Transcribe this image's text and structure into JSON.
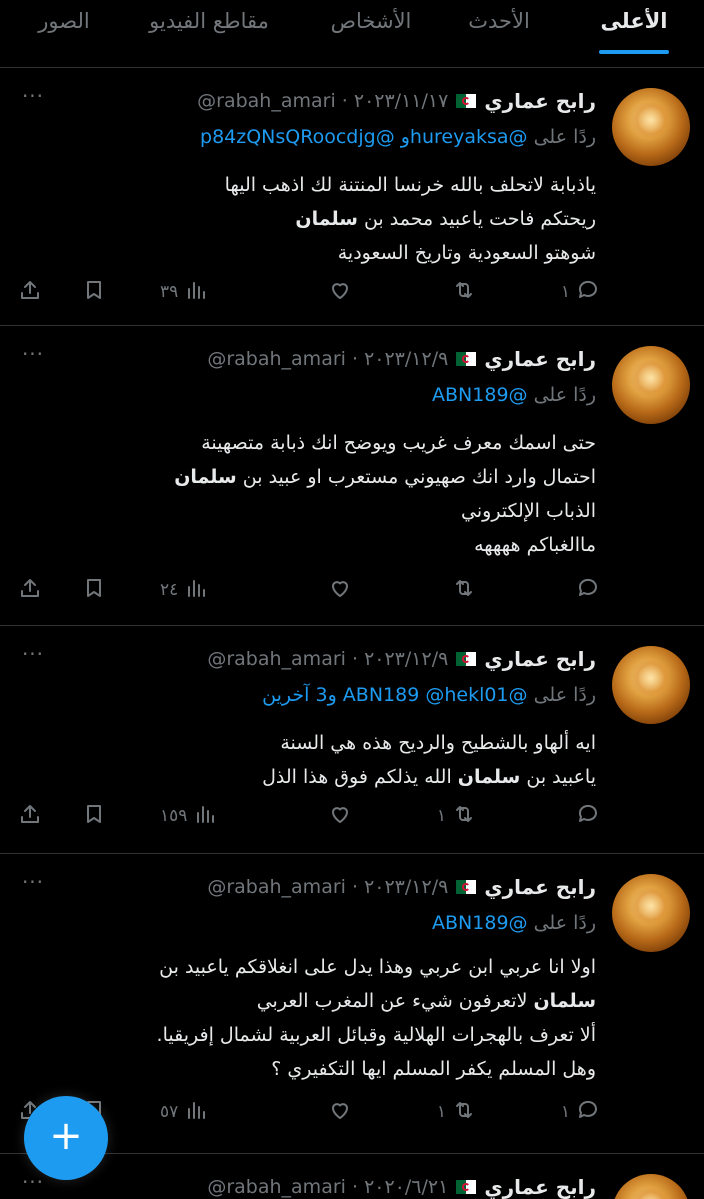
{
  "tabs": [
    {
      "label": "الأعلى",
      "active": true
    },
    {
      "label": "الأحدث",
      "active": false
    },
    {
      "label": "الأشخاص",
      "active": false
    },
    {
      "label": "مقاطع الفيديو",
      "active": false
    },
    {
      "label": "الصور",
      "active": false
    }
  ],
  "tweets": [
    {
      "name": "رابح عماري",
      "meta": "@rabah_amari · ٢٠٢٣/١١/١٧",
      "reply_prefix": "ردًا على ",
      "reply_handles": "@hureyaksa‏و @p84zQNsQRoocdjg",
      "body_html_lines": [
        "ياذبابة لاتحلف بالله خرنسا المنتنة لك اذهب اليها",
        "ريحتكم فاحت ياعبيد محمد بن |سلمان|",
        "شوهتو السعودية وتاريخ السعودية"
      ],
      "replies": "١",
      "retweets": "",
      "likes": "",
      "views": "٣٩"
    },
    {
      "name": "رابح عماري",
      "meta": "@rabah_amari · ٢٠٢٣/١٢/٩",
      "reply_prefix": "ردًا على ",
      "reply_handles": "@ABN189",
      "body_html_lines": [
        "حتى اسمك معرف غريب ويوضح انك ذبابة متصهينة",
        "احتمال وارد انك صهيوني مستعرب او عبيد بن |سلمان|",
        "الذباب الإلكتروني",
        "ماالغباكم ههههه"
      ],
      "replies": "",
      "retweets": "",
      "likes": "",
      "views": "٢٤"
    },
    {
      "name": "رابح عماري",
      "meta": "@rabah_amari · ٢٠٢٣/١٢/٩",
      "reply_prefix": "ردًا على ",
      "reply_handles": "@ABN189 @hekl01 و3 آخرين",
      "body_html_lines": [
        "ايه ألهاو بالشطيح والرديح هذه هي السنة",
        "ياعبيد بن |سلمان| الله يذلكم فوق هذا الذل"
      ],
      "replies": "",
      "retweets": "١",
      "likes": "",
      "views": "١٥٩"
    },
    {
      "name": "رابح عماري",
      "meta": "@rabah_amari · ٢٠٢٣/١٢/٩",
      "reply_prefix": "ردًا على ",
      "reply_handles": "@ABN189",
      "body_html_lines": [
        "اولا انا عربي ابن عربي وهذا يدل على انغلاقكم ياعبيد بن",
        "|سلمان| لاتعرفون  شيء عن المغرب العربي",
        "ألا تعرف بالهجرات الهلالية وقبائل العربية لشمال إفريقيا.",
        "وهل المسلم يكفر المسلم ايها التكفيري ؟"
      ],
      "replies": "١",
      "retweets": "١",
      "likes": "",
      "views": "٥٧"
    },
    {
      "name": "رابح عماري",
      "meta": "@rabah_amari · ٢٠٢٠/٦/٢١",
      "reply_prefix": "",
      "reply_handles": "",
      "body_html_lines": [],
      "replies": "",
      "retweets": "",
      "likes": "",
      "views": ""
    }
  ],
  "icons": {
    "more": "more-icon",
    "reply": "reply-icon",
    "retweet": "retweet-icon",
    "like": "heart-icon",
    "views": "views-icon",
    "bookmark": "bookmark-icon",
    "share": "share-icon",
    "compose": "plus-icon"
  },
  "colors": {
    "accent": "#1d9bf0",
    "muted": "#71767b",
    "text": "#e7e9ea",
    "bg": "#000000"
  },
  "fab": {
    "label": "+"
  }
}
